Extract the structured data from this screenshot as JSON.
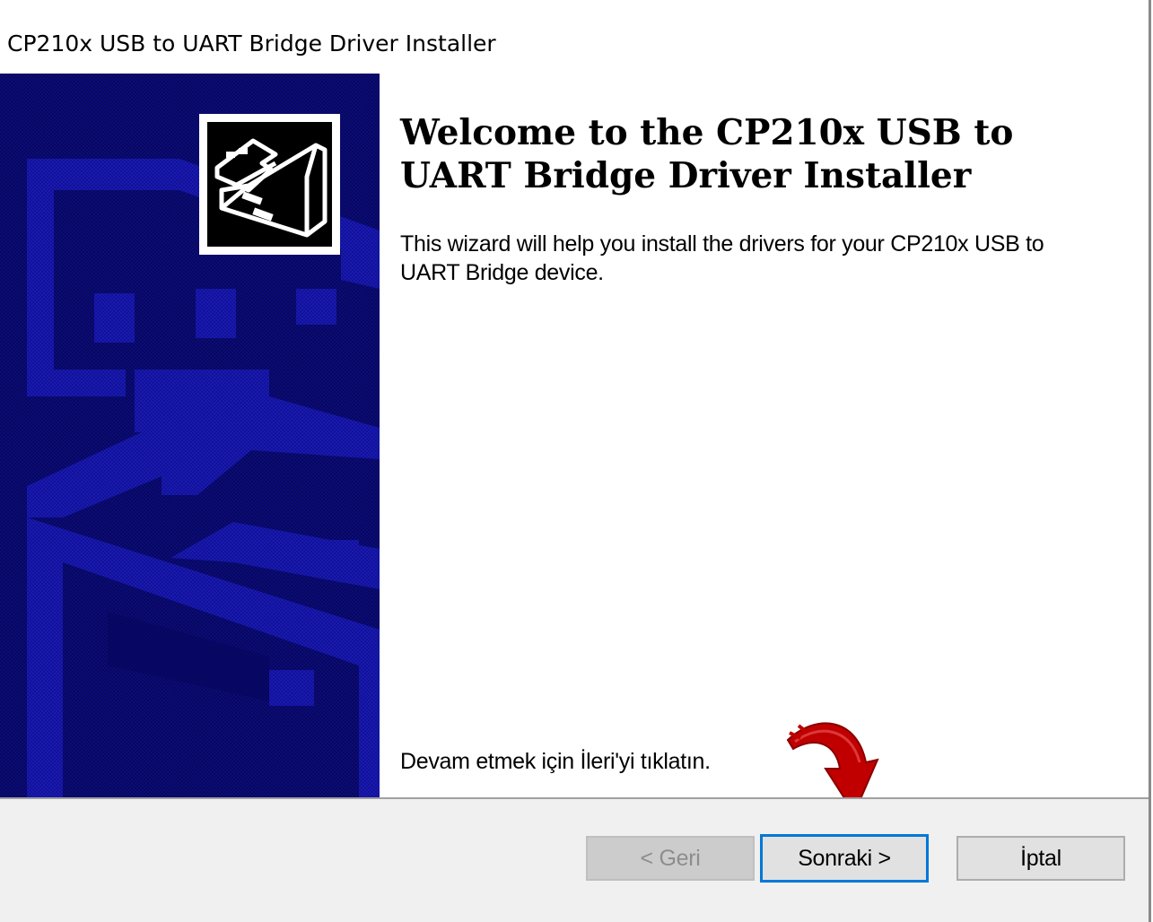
{
  "window": {
    "title": "CP210x USB to UART Bridge Driver Installer"
  },
  "welcome": {
    "title": "Welcome to the CP210x USB to UART Bridge Driver Installer",
    "description": "This wizard will help you install the drivers for your CP210x USB to UART Bridge device.",
    "hint": "Devam etmek için İleri'yi tıklatın."
  },
  "buttons": {
    "back_label": "< Geri",
    "next_label": "Sonraki >",
    "cancel_label": "İptal"
  },
  "icons": {
    "banner": "hardware-install-banner",
    "logo": "device-install-icon",
    "annotation": "red-arrow-icon"
  },
  "colors": {
    "banner_bg": "#07075e",
    "focus_border": "#0078d7",
    "arrow": "#c00000"
  }
}
